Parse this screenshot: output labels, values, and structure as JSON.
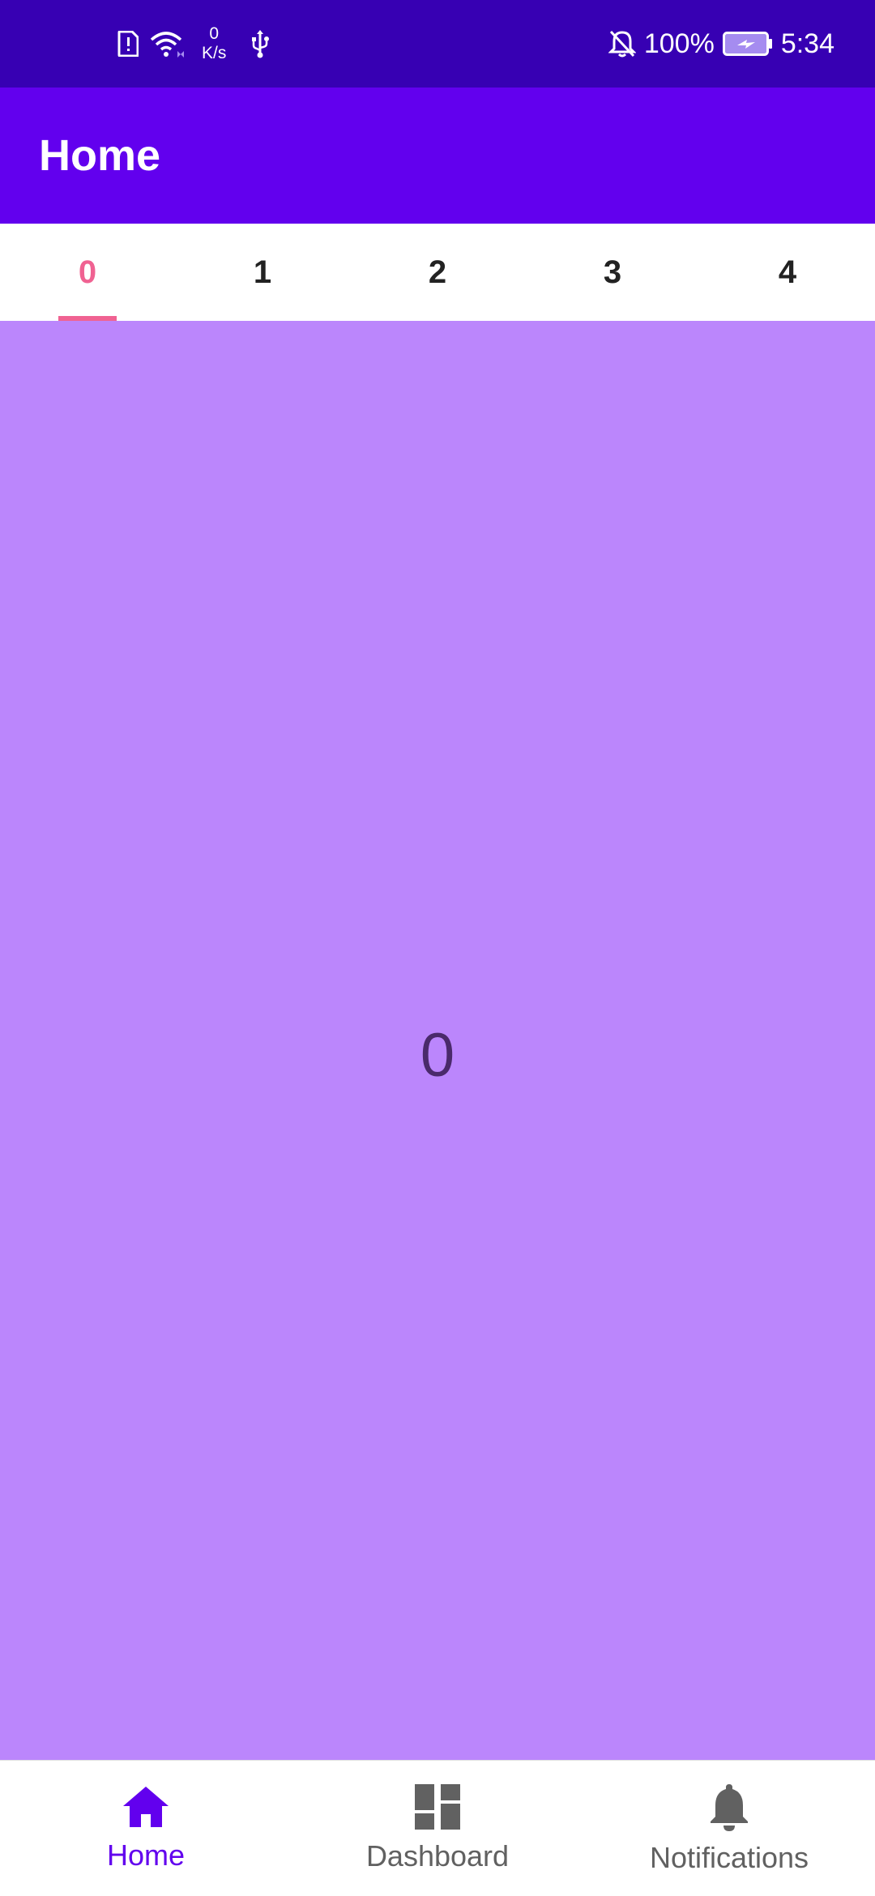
{
  "status_bar": {
    "net_speed_value": "0",
    "net_speed_unit": "K/s",
    "battery_percent": "100%",
    "time": "5:34",
    "icons": [
      "sim-alert-icon",
      "wifi-icon",
      "usb-icon",
      "notifications-off-icon",
      "battery-charging-icon"
    ]
  },
  "app_bar": {
    "title": "Home"
  },
  "tabs": [
    {
      "label": "0",
      "selected": true
    },
    {
      "label": "1",
      "selected": false
    },
    {
      "label": "2",
      "selected": false
    },
    {
      "label": "3",
      "selected": false
    },
    {
      "label": "4",
      "selected": false
    }
  ],
  "content": {
    "page_number": "0"
  },
  "bottom_nav": {
    "items": [
      {
        "label": "Home",
        "icon": "home-icon",
        "selected": true
      },
      {
        "label": "Dashboard",
        "icon": "dashboard-icon",
        "selected": false
      },
      {
        "label": "Notifications",
        "icon": "bell-icon",
        "selected": false
      }
    ]
  },
  "colors": {
    "status_bar": "#3700B3",
    "primary": "#6200EE",
    "accent": "#F06292",
    "content_bg": "#BB86FC"
  }
}
